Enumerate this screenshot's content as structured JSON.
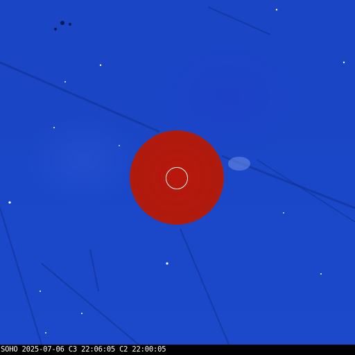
{
  "image": {
    "subject": "solar coronagraph composite",
    "colors": {
      "background": "#1a47c7",
      "occulter": "#b01a0d",
      "sun_outline": "#ffffff",
      "caption_bg": "#000000",
      "caption_text": "#ffffff"
    }
  },
  "caption": {
    "observatory": "SOHO",
    "date": "2025-07-06",
    "c3_time": "C3 22:06:05",
    "c2_time": "C2 22:00:05"
  }
}
